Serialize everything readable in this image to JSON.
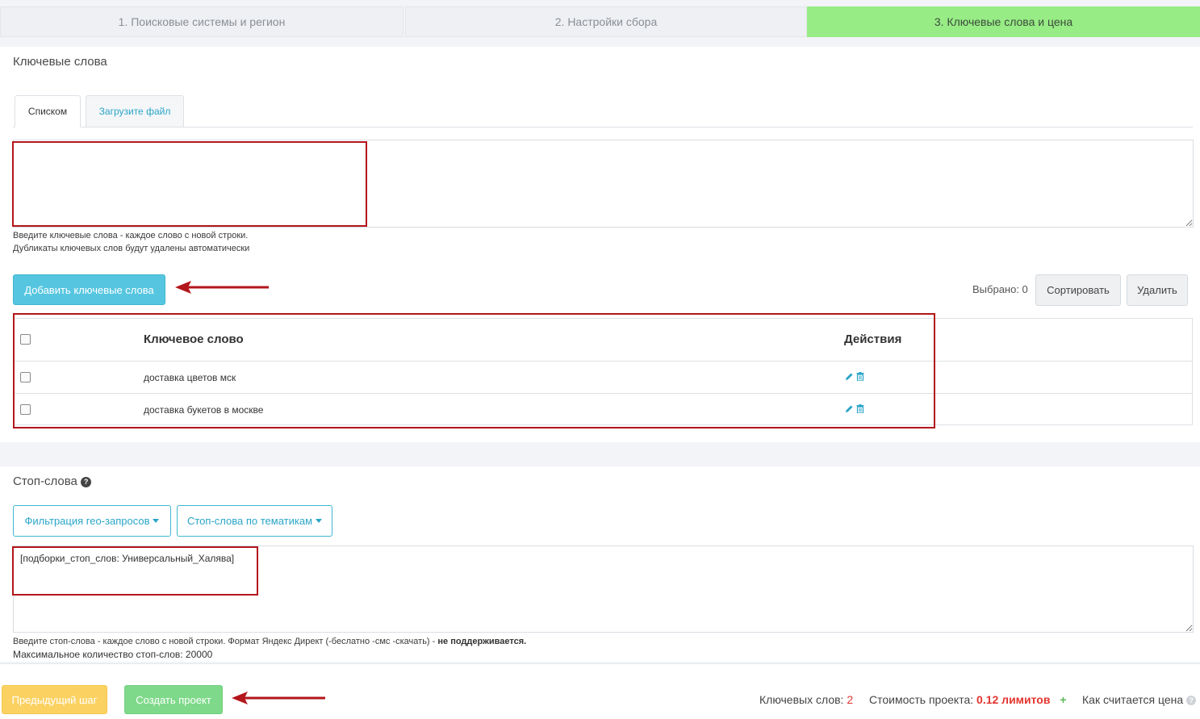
{
  "steps": [
    {
      "label": "1. Поисковые системы и регион"
    },
    {
      "label": "2. Настройки сбора"
    },
    {
      "label": "3. Ключевые слова и цена"
    }
  ],
  "keywords_section": {
    "title": "Ключевые слова",
    "tabs": [
      {
        "label": "Списком"
      },
      {
        "label": "Загрузите файл"
      }
    ],
    "textarea_value": "",
    "hint_line1": "Введите ключевые слова - каждое слово с новой строки.",
    "hint_line2": "Дубликаты ключевых слов будут удалены автоматически",
    "add_button": "Добавить ключевые слова",
    "selected_label": "Выбрано: 0",
    "sort_button": "Сортировать",
    "delete_button": "Удалить",
    "table": {
      "columns": [
        "Ключевое слово",
        "Действия"
      ],
      "rows": [
        {
          "keyword": "доставка цветов мск"
        },
        {
          "keyword": "доставка букетов в москве"
        }
      ]
    }
  },
  "stop_section": {
    "title": "Стоп-слова",
    "help_icon": "question-circle-icon",
    "geo_dropdown": "Фильтрация гео-запросов",
    "theme_dropdown": "Стоп-слова по тематикам",
    "textarea_value": "[подборки_стоп_слов: Универсальный_Халява]",
    "hint_text": "Введите стоп-слова - каждое слово с новой строки. Формат Яндекс Директ (-беслатно -смс -скачать) - ",
    "hint_bold": "не поддерживается.",
    "max_words": "Максимальное количество стоп-слов: 20000"
  },
  "footer": {
    "prev_button": "Предыдущий шаг",
    "create_button": "Создать проект",
    "keywords_count_label": "Ключевых слов:",
    "keywords_count": "2",
    "cost_label": "Стоимость проекта:",
    "cost_value": "0.12 лимитов",
    "plus": "+",
    "how_label": "Как считается цена"
  },
  "colors": {
    "active_step": "#97ec85",
    "accent": "#56c6e0",
    "annotation": "#b3161b"
  }
}
